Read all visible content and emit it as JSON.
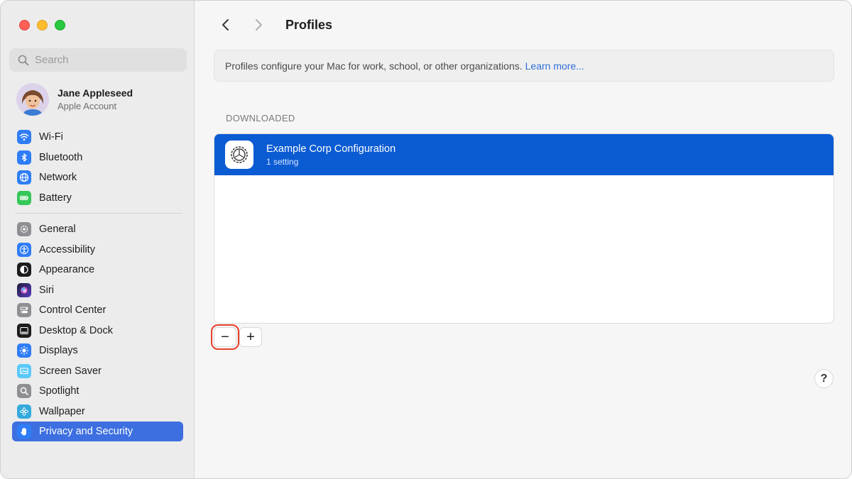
{
  "sidebar": {
    "search_placeholder": "Search",
    "account": {
      "name": "Jane Appleseed",
      "subtitle": "Apple Account"
    },
    "group1": [
      {
        "label": "Wi-Fi",
        "icon": "wifi-icon",
        "color": "#2f7df6"
      },
      {
        "label": "Bluetooth",
        "icon": "bluetooth-icon",
        "color": "#2f7df6"
      },
      {
        "label": "Network",
        "icon": "globe-icon",
        "color": "#2f7df6"
      },
      {
        "label": "Battery",
        "icon": "battery-icon",
        "color": "#34c759"
      }
    ],
    "group2": [
      {
        "label": "General",
        "icon": "gear-icon",
        "color": "#8e8e93"
      },
      {
        "label": "Accessibility",
        "icon": "accessibility-icon",
        "color": "#2f7df6"
      },
      {
        "label": "Appearance",
        "icon": "appearance-icon",
        "color": "#1c1c1e"
      },
      {
        "label": "Siri",
        "icon": "siri-icon",
        "color": "#5a3fc0"
      },
      {
        "label": "Control Center",
        "icon": "control-center-icon",
        "color": "#8e8e93"
      },
      {
        "label": "Desktop & Dock",
        "icon": "dock-icon",
        "color": "#1c1c1e"
      },
      {
        "label": "Displays",
        "icon": "sun-icon",
        "color": "#2f7df6"
      },
      {
        "label": "Screen Saver",
        "icon": "screen-saver-icon",
        "color": "#5ac8fa"
      },
      {
        "label": "Spotlight",
        "icon": "magnifier-icon",
        "color": "#8e8e93"
      },
      {
        "label": "Wallpaper",
        "icon": "flower-icon",
        "color": "#34aadc"
      },
      {
        "label": "Privacy and Security",
        "icon": "hand-icon",
        "color": "#2f7df6",
        "selected": true
      }
    ]
  },
  "main": {
    "title": "Profiles",
    "info_text": "Profiles configure your Mac for work, school, or other organizations.",
    "info_link": "Learn more...",
    "section_label": "DOWNLOADED",
    "profiles": [
      {
        "title": "Example Corp Configuration",
        "subtitle": "1 setting",
        "selected": true
      }
    ],
    "remove_label": "−",
    "add_label": "+",
    "help_label": "?"
  },
  "colors": {
    "accent": "#0b5bd3",
    "sidebar_selected": "#3d6fe0",
    "highlight": "#e8412c",
    "link": "#2f6fd6"
  }
}
